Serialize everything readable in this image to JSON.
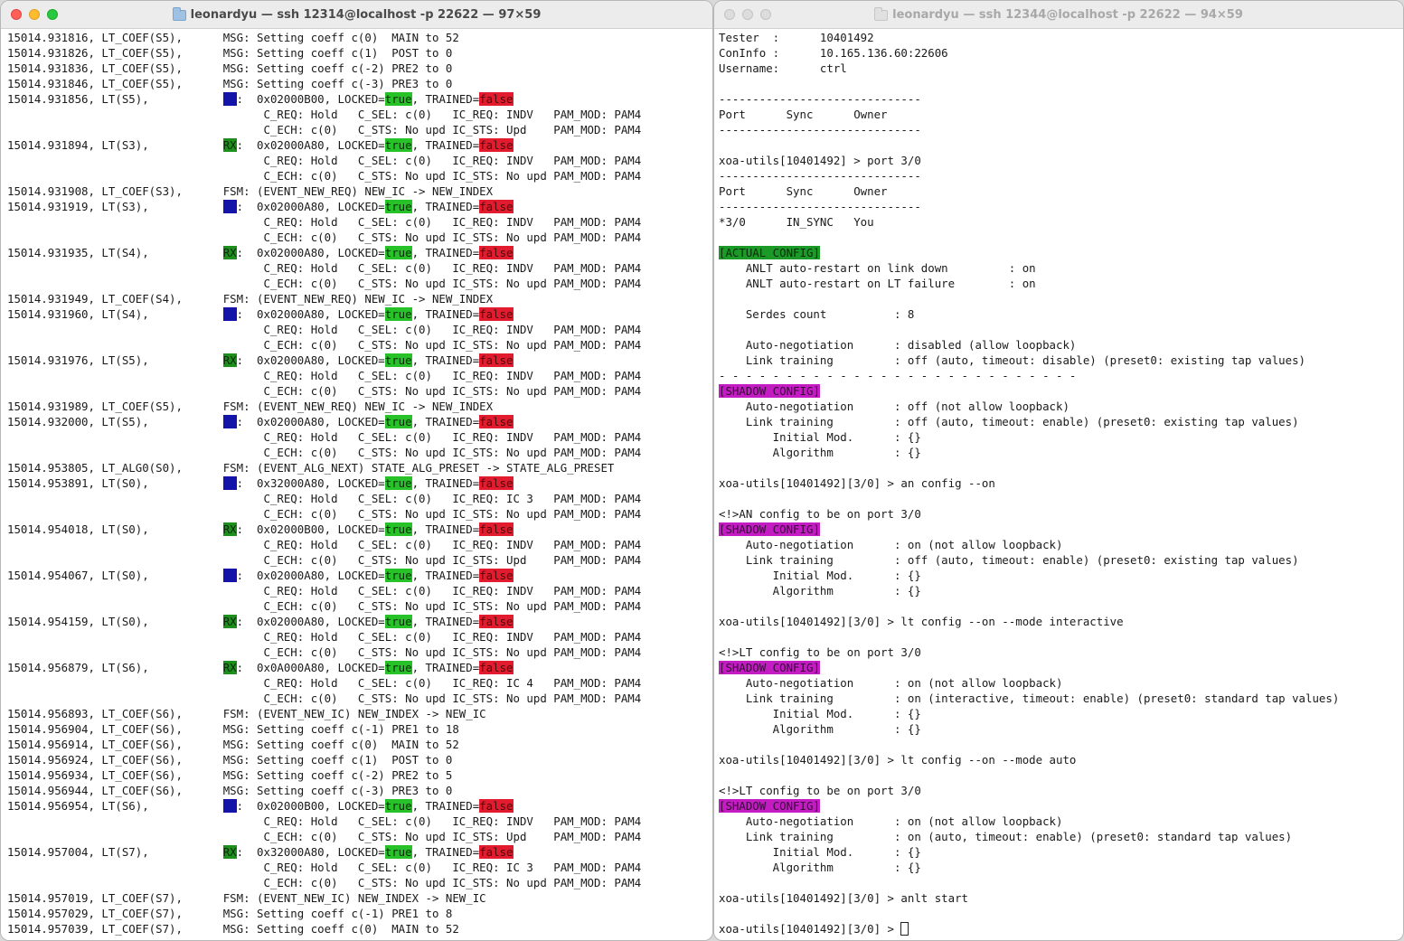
{
  "left_window": {
    "title": "leonardyu — ssh 12314@localhost -p 22622 — 97×59",
    "lines": [
      [
        {
          "t": "15014.931816, LT_COEF(S5),      MSG: Setting coeff c(0)  MAIN to 52"
        }
      ],
      [
        {
          "t": "15014.931826, LT_COEF(S5),      MSG: Setting coeff c(1)  POST to 0"
        }
      ],
      [
        {
          "t": "15014.931836, LT_COEF(S5),      MSG: Setting coeff c(-2) PRE2 to 0"
        }
      ],
      [
        {
          "t": "15014.931846, LT_COEF(S5),      MSG: Setting coeff c(-3) PRE3 to 0"
        }
      ],
      [
        {
          "t": "15014.931856, LT(S5),           "
        },
        {
          "t": "TX",
          "c": "tx"
        },
        {
          "t": ":  0x02000B00, LOCKED="
        },
        {
          "t": "true",
          "c": "true"
        },
        {
          "t": ", TRAINED="
        },
        {
          "t": "false",
          "c": "false"
        }
      ],
      [
        {
          "t": "                                      C_REQ: Hold   C_SEL: c(0)   IC_REQ: INDV   PAM_MOD: PAM4"
        }
      ],
      [
        {
          "t": "                                      C_ECH: c(0)   C_STS: No upd IC_STS: Upd    PAM_MOD: PAM4"
        }
      ],
      [
        {
          "t": "15014.931894, LT(S3),           "
        },
        {
          "t": "RX",
          "c": "rx"
        },
        {
          "t": ":  0x02000A80, LOCKED="
        },
        {
          "t": "true",
          "c": "true"
        },
        {
          "t": ", TRAINED="
        },
        {
          "t": "false",
          "c": "false"
        }
      ],
      [
        {
          "t": "                                      C_REQ: Hold   C_SEL: c(0)   IC_REQ: INDV   PAM_MOD: PAM4"
        }
      ],
      [
        {
          "t": "                                      C_ECH: c(0)   C_STS: No upd IC_STS: No upd PAM_MOD: PAM4"
        }
      ],
      [
        {
          "t": "15014.931908, LT_COEF(S3),      FSM: (EVENT_NEW_REQ) NEW_IC -> NEW_INDEX"
        }
      ],
      [
        {
          "t": "15014.931919, LT(S3),           "
        },
        {
          "t": "TX",
          "c": "tx"
        },
        {
          "t": ":  0x02000A80, LOCKED="
        },
        {
          "t": "true",
          "c": "true"
        },
        {
          "t": ", TRAINED="
        },
        {
          "t": "false",
          "c": "false"
        }
      ],
      [
        {
          "t": "                                      C_REQ: Hold   C_SEL: c(0)   IC_REQ: INDV   PAM_MOD: PAM4"
        }
      ],
      [
        {
          "t": "                                      C_ECH: c(0)   C_STS: No upd IC_STS: No upd PAM_MOD: PAM4"
        }
      ],
      [
        {
          "t": "15014.931935, LT(S4),           "
        },
        {
          "t": "RX",
          "c": "rx"
        },
        {
          "t": ":  0x02000A80, LOCKED="
        },
        {
          "t": "true",
          "c": "true"
        },
        {
          "t": ", TRAINED="
        },
        {
          "t": "false",
          "c": "false"
        }
      ],
      [
        {
          "t": "                                      C_REQ: Hold   C_SEL: c(0)   IC_REQ: INDV   PAM_MOD: PAM4"
        }
      ],
      [
        {
          "t": "                                      C_ECH: c(0)   C_STS: No upd IC_STS: No upd PAM_MOD: PAM4"
        }
      ],
      [
        {
          "t": "15014.931949, LT_COEF(S4),      FSM: (EVENT_NEW_REQ) NEW_IC -> NEW_INDEX"
        }
      ],
      [
        {
          "t": "15014.931960, LT(S4),           "
        },
        {
          "t": "TX",
          "c": "tx"
        },
        {
          "t": ":  0x02000A80, LOCKED="
        },
        {
          "t": "true",
          "c": "true"
        },
        {
          "t": ", TRAINED="
        },
        {
          "t": "false",
          "c": "false"
        }
      ],
      [
        {
          "t": "                                      C_REQ: Hold   C_SEL: c(0)   IC_REQ: INDV   PAM_MOD: PAM4"
        }
      ],
      [
        {
          "t": "                                      C_ECH: c(0)   C_STS: No upd IC_STS: No upd PAM_MOD: PAM4"
        }
      ],
      [
        {
          "t": "15014.931976, LT(S5),           "
        },
        {
          "t": "RX",
          "c": "rx"
        },
        {
          "t": ":  0x02000A80, LOCKED="
        },
        {
          "t": "true",
          "c": "true"
        },
        {
          "t": ", TRAINED="
        },
        {
          "t": "false",
          "c": "false"
        }
      ],
      [
        {
          "t": "                                      C_REQ: Hold   C_SEL: c(0)   IC_REQ: INDV   PAM_MOD: PAM4"
        }
      ],
      [
        {
          "t": "                                      C_ECH: c(0)   C_STS: No upd IC_STS: No upd PAM_MOD: PAM4"
        }
      ],
      [
        {
          "t": "15014.931989, LT_COEF(S5),      FSM: (EVENT_NEW_REQ) NEW_IC -> NEW_INDEX"
        }
      ],
      [
        {
          "t": "15014.932000, LT(S5),           "
        },
        {
          "t": "TX",
          "c": "tx"
        },
        {
          "t": ":  0x02000A80, LOCKED="
        },
        {
          "t": "true",
          "c": "true"
        },
        {
          "t": ", TRAINED="
        },
        {
          "t": "false",
          "c": "false"
        }
      ],
      [
        {
          "t": "                                      C_REQ: Hold   C_SEL: c(0)   IC_REQ: INDV   PAM_MOD: PAM4"
        }
      ],
      [
        {
          "t": "                                      C_ECH: c(0)   C_STS: No upd IC_STS: No upd PAM_MOD: PAM4"
        }
      ],
      [
        {
          "t": "15014.953805, LT_ALG0(S0),      FSM: (EVENT_ALG_NEXT) STATE_ALG_PRESET -> STATE_ALG_PRESET"
        }
      ],
      [
        {
          "t": "15014.953891, LT(S0),           "
        },
        {
          "t": "TX",
          "c": "tx"
        },
        {
          "t": ":  0x32000A80, LOCKED="
        },
        {
          "t": "true",
          "c": "true"
        },
        {
          "t": ", TRAINED="
        },
        {
          "t": "false",
          "c": "false"
        }
      ],
      [
        {
          "t": "                                      C_REQ: Hold   C_SEL: c(0)   IC_REQ: IC 3   PAM_MOD: PAM4"
        }
      ],
      [
        {
          "t": "                                      C_ECH: c(0)   C_STS: No upd IC_STS: No upd PAM_MOD: PAM4"
        }
      ],
      [
        {
          "t": "15014.954018, LT(S0),           "
        },
        {
          "t": "RX",
          "c": "rx"
        },
        {
          "t": ":  0x02000B00, LOCKED="
        },
        {
          "t": "true",
          "c": "true"
        },
        {
          "t": ", TRAINED="
        },
        {
          "t": "false",
          "c": "false"
        }
      ],
      [
        {
          "t": "                                      C_REQ: Hold   C_SEL: c(0)   IC_REQ: INDV   PAM_MOD: PAM4"
        }
      ],
      [
        {
          "t": "                                      C_ECH: c(0)   C_STS: No upd IC_STS: Upd    PAM_MOD: PAM4"
        }
      ],
      [
        {
          "t": "15014.954067, LT(S0),           "
        },
        {
          "t": "TX",
          "c": "tx"
        },
        {
          "t": ":  0x02000A80, LOCKED="
        },
        {
          "t": "true",
          "c": "true"
        },
        {
          "t": ", TRAINED="
        },
        {
          "t": "false",
          "c": "false"
        }
      ],
      [
        {
          "t": "                                      C_REQ: Hold   C_SEL: c(0)   IC_REQ: INDV   PAM_MOD: PAM4"
        }
      ],
      [
        {
          "t": "                                      C_ECH: c(0)   C_STS: No upd IC_STS: No upd PAM_MOD: PAM4"
        }
      ],
      [
        {
          "t": "15014.954159, LT(S0),           "
        },
        {
          "t": "RX",
          "c": "rx"
        },
        {
          "t": ":  0x02000A80, LOCKED="
        },
        {
          "t": "true",
          "c": "true"
        },
        {
          "t": ", TRAINED="
        },
        {
          "t": "false",
          "c": "false"
        }
      ],
      [
        {
          "t": "                                      C_REQ: Hold   C_SEL: c(0)   IC_REQ: INDV   PAM_MOD: PAM4"
        }
      ],
      [
        {
          "t": "                                      C_ECH: c(0)   C_STS: No upd IC_STS: No upd PAM_MOD: PAM4"
        }
      ],
      [
        {
          "t": "15014.956879, LT(S6),           "
        },
        {
          "t": "RX",
          "c": "rx"
        },
        {
          "t": ":  0x0A000A80, LOCKED="
        },
        {
          "t": "true",
          "c": "true"
        },
        {
          "t": ", TRAINED="
        },
        {
          "t": "false",
          "c": "false"
        }
      ],
      [
        {
          "t": "                                      C_REQ: Hold   C_SEL: c(0)   IC_REQ: IC 4   PAM_MOD: PAM4"
        }
      ],
      [
        {
          "t": "                                      C_ECH: c(0)   C_STS: No upd IC_STS: No upd PAM_MOD: PAM4"
        }
      ],
      [
        {
          "t": "15014.956893, LT_COEF(S6),      FSM: (EVENT_NEW_IC) NEW_INDEX -> NEW_IC"
        }
      ],
      [
        {
          "t": "15014.956904, LT_COEF(S6),      MSG: Setting coeff c(-1) PRE1 to 18"
        }
      ],
      [
        {
          "t": "15014.956914, LT_COEF(S6),      MSG: Setting coeff c(0)  MAIN to 52"
        }
      ],
      [
        {
          "t": "15014.956924, LT_COEF(S6),      MSG: Setting coeff c(1)  POST to 0"
        }
      ],
      [
        {
          "t": "15014.956934, LT_COEF(S6),      MSG: Setting coeff c(-2) PRE2 to 5"
        }
      ],
      [
        {
          "t": "15014.956944, LT_COEF(S6),      MSG: Setting coeff c(-3) PRE3 to 0"
        }
      ],
      [
        {
          "t": "15014.956954, LT(S6),           "
        },
        {
          "t": "TX",
          "c": "tx"
        },
        {
          "t": ":  0x02000B00, LOCKED="
        },
        {
          "t": "true",
          "c": "true"
        },
        {
          "t": ", TRAINED="
        },
        {
          "t": "false",
          "c": "false"
        }
      ],
      [
        {
          "t": "                                      C_REQ: Hold   C_SEL: c(0)   IC_REQ: INDV   PAM_MOD: PAM4"
        }
      ],
      [
        {
          "t": "                                      C_ECH: c(0)   C_STS: No upd IC_STS: Upd    PAM_MOD: PAM4"
        }
      ],
      [
        {
          "t": "15014.957004, LT(S7),           "
        },
        {
          "t": "RX",
          "c": "rx"
        },
        {
          "t": ":  0x32000A80, LOCKED="
        },
        {
          "t": "true",
          "c": "true"
        },
        {
          "t": ", TRAINED="
        },
        {
          "t": "false",
          "c": "false"
        }
      ],
      [
        {
          "t": "                                      C_REQ: Hold   C_SEL: c(0)   IC_REQ: IC 3   PAM_MOD: PAM4"
        }
      ],
      [
        {
          "t": "                                      C_ECH: c(0)   C_STS: No upd IC_STS: No upd PAM_MOD: PAM4"
        }
      ],
      [
        {
          "t": "15014.957019, LT_COEF(S7),      FSM: (EVENT_NEW_IC) NEW_INDEX -> NEW_IC"
        }
      ],
      [
        {
          "t": "15014.957029, LT_COEF(S7),      MSG: Setting coeff c(-1) PRE1 to 8"
        }
      ],
      [
        {
          "t": "15014.957039, LT_COEF(S7),      MSG: Setting coeff c(0)  MAIN to 52"
        }
      ]
    ]
  },
  "right_window": {
    "title": "leonardyu — ssh 12344@localhost -p 22622 — 94×59",
    "cursor": true,
    "lines": [
      [
        {
          "t": "Tester  :      10401492"
        }
      ],
      [
        {
          "t": "ConInfo :      10.165.136.60:22606"
        }
      ],
      [
        {
          "t": "Username:      ctrl"
        }
      ],
      [
        {
          "t": ""
        }
      ],
      [
        {
          "t": "------------------------------"
        }
      ],
      [
        {
          "t": "Port      Sync      Owner"
        }
      ],
      [
        {
          "t": "------------------------------"
        }
      ],
      [
        {
          "t": ""
        }
      ],
      [
        {
          "t": "xoa-utils[10401492] > port 3/0"
        }
      ],
      [
        {
          "t": "------------------------------"
        }
      ],
      [
        {
          "t": "Port      Sync      Owner"
        }
      ],
      [
        {
          "t": "------------------------------"
        }
      ],
      [
        {
          "t": "*3/0      IN_SYNC   You"
        }
      ],
      [
        {
          "t": ""
        }
      ],
      [
        {
          "t": "[ACTUAL CONFIG]",
          "c": "actual"
        }
      ],
      [
        {
          "t": "    ANLT auto-restart on link down         : on"
        }
      ],
      [
        {
          "t": "    ANLT auto-restart on LT failure        : on"
        }
      ],
      [
        {
          "t": ""
        }
      ],
      [
        {
          "t": "    Serdes count          : 8"
        }
      ],
      [
        {
          "t": ""
        }
      ],
      [
        {
          "t": "    Auto-negotiation      : disabled (allow loopback)"
        }
      ],
      [
        {
          "t": "    Link training         : off (auto, timeout: disable) (preset0: existing tap values)"
        }
      ],
      [
        {
          "t": "- - - - - - - - - - - - - - - - - - - - - - - - - - -"
        }
      ],
      [
        {
          "t": "[SHADOW CONFIG]",
          "c": "shadow"
        }
      ],
      [
        {
          "t": "    Auto-negotiation      : off (not allow loopback)"
        }
      ],
      [
        {
          "t": "    Link training         : off (auto, timeout: enable) (preset0: existing tap values)"
        }
      ],
      [
        {
          "t": "        Initial Mod.      : {}"
        }
      ],
      [
        {
          "t": "        Algorithm         : {}"
        }
      ],
      [
        {
          "t": ""
        }
      ],
      [
        {
          "t": "xoa-utils[10401492][3/0] > an config --on"
        }
      ],
      [
        {
          "t": ""
        }
      ],
      [
        {
          "t": "<!>AN config to be on port 3/0"
        }
      ],
      [
        {
          "t": "[SHADOW CONFIG]",
          "c": "shadow"
        }
      ],
      [
        {
          "t": "    Auto-negotiation      : on (not allow loopback)"
        }
      ],
      [
        {
          "t": "    Link training         : off (auto, timeout: enable) (preset0: existing tap values)"
        }
      ],
      [
        {
          "t": "        Initial Mod.      : {}"
        }
      ],
      [
        {
          "t": "        Algorithm         : {}"
        }
      ],
      [
        {
          "t": ""
        }
      ],
      [
        {
          "t": "xoa-utils[10401492][3/0] > lt config --on --mode interactive"
        }
      ],
      [
        {
          "t": ""
        }
      ],
      [
        {
          "t": "<!>LT config to be on port 3/0"
        }
      ],
      [
        {
          "t": "[SHADOW CONFIG]",
          "c": "shadow"
        }
      ],
      [
        {
          "t": "    Auto-negotiation      : on (not allow loopback)"
        }
      ],
      [
        {
          "t": "    Link training         : on (interactive, timeout: enable) (preset0: standard tap values)"
        }
      ],
      [
        {
          "t": "        Initial Mod.      : {}"
        }
      ],
      [
        {
          "t": "        Algorithm         : {}"
        }
      ],
      [
        {
          "t": ""
        }
      ],
      [
        {
          "t": "xoa-utils[10401492][3/0] > lt config --on --mode auto"
        }
      ],
      [
        {
          "t": ""
        }
      ],
      [
        {
          "t": "<!>LT config to be on port 3/0"
        }
      ],
      [
        {
          "t": "[SHADOW CONFIG]",
          "c": "shadow"
        }
      ],
      [
        {
          "t": "    Auto-negotiation      : on (not allow loopback)"
        }
      ],
      [
        {
          "t": "    Link training         : on (auto, timeout: enable) (preset0: standard tap values)"
        }
      ],
      [
        {
          "t": "        Initial Mod.      : {}"
        }
      ],
      [
        {
          "t": "        Algorithm         : {}"
        }
      ],
      [
        {
          "t": ""
        }
      ],
      [
        {
          "t": "xoa-utils[10401492][3/0] > anlt start"
        }
      ],
      [
        {
          "t": ""
        }
      ],
      [
        {
          "t": "xoa-utils[10401492][3/0] > "
        }
      ]
    ]
  },
  "colors": {
    "tx": "#1414a8",
    "rx": "#1c8f1c",
    "true": "#27c227",
    "false": "#e21c2e",
    "actual_config": "#1c9a28",
    "shadow_config": "#c21cc2"
  },
  "icons": {
    "traffic_lights": [
      "close-icon",
      "minimize-icon",
      "zoom-icon"
    ],
    "title_icon": "folder-icon"
  }
}
